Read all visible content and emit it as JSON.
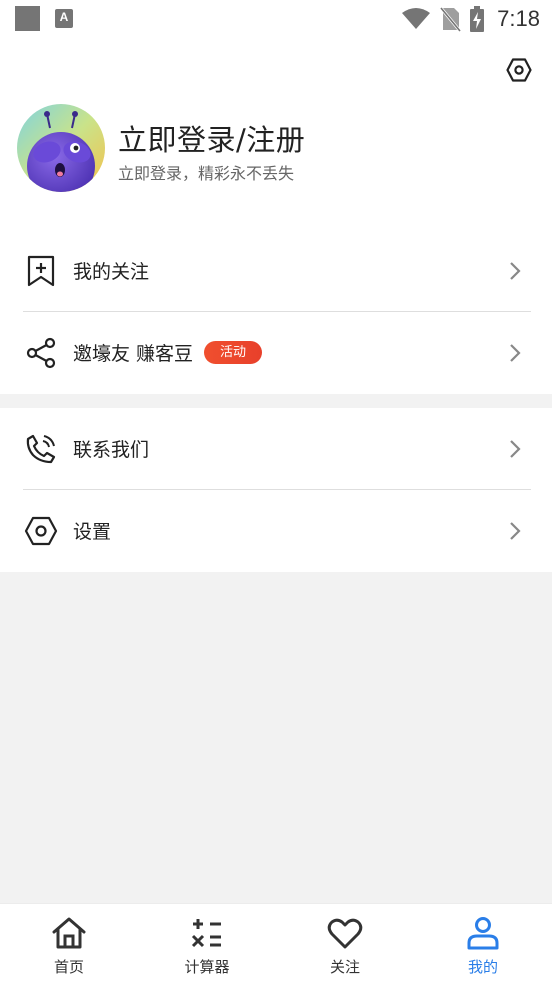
{
  "status_bar": {
    "time": "7:18"
  },
  "header": {
    "title": "立即登录/注册",
    "subtitle": "立即登录，精彩永不丢失"
  },
  "menu": {
    "items": [
      {
        "label": "我的关注",
        "icon": "bookmark-plus-icon"
      },
      {
        "label": "邀壕友 赚客豆",
        "icon": "share-icon",
        "badge": "活动"
      },
      {
        "label": "联系我们",
        "icon": "phone-icon"
      },
      {
        "label": "设置",
        "icon": "hexagon-settings-icon"
      }
    ]
  },
  "tabs": [
    {
      "label": "首页",
      "icon": "home-icon",
      "active": false
    },
    {
      "label": "计算器",
      "icon": "calculator-icon",
      "active": false
    },
    {
      "label": "关注",
      "icon": "heart-icon",
      "active": false
    },
    {
      "label": "我的",
      "icon": "person-icon",
      "active": true
    }
  ],
  "colors": {
    "accent": "#2a7ee8",
    "badge": "#e8402b",
    "background": "#f2f2f2"
  }
}
